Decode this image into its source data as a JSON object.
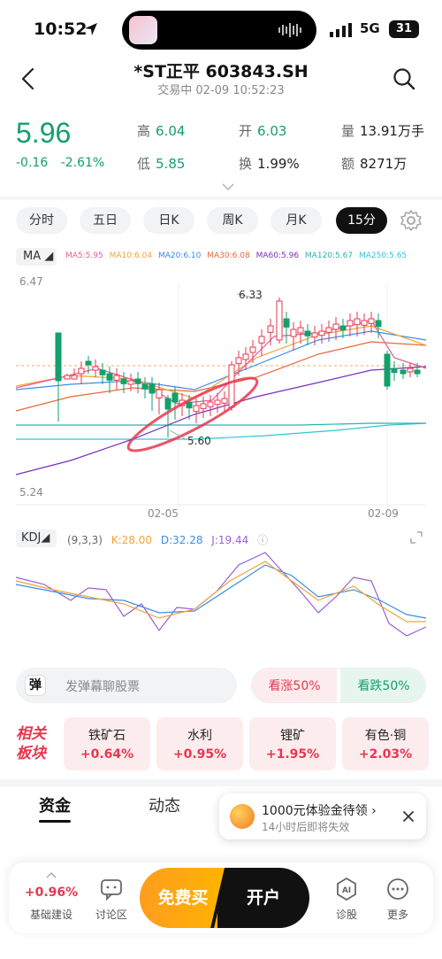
{
  "status_bar": {
    "time": "10:52",
    "network": "5G",
    "battery": "31"
  },
  "header": {
    "title": "*ST正平 603843.SH",
    "subtitle": "交易中 02-09 10:52:23"
  },
  "quote": {
    "price": "5.96",
    "change": "-0.16",
    "change_pct": "-2.61%",
    "high_label": "高",
    "high": "6.04",
    "low_label": "低",
    "low": "5.85",
    "open_label": "开",
    "open": "6.03",
    "turnover_label": "换",
    "turnover": "1.99%",
    "volume_label": "量",
    "volume": "13.91万手",
    "amount_label": "额",
    "amount": "8271万"
  },
  "period_tabs": [
    "分时",
    "五日",
    "日K",
    "周K",
    "月K",
    "15分"
  ],
  "active_tab": "15分",
  "ma": {
    "selector": "MA",
    "items": [
      {
        "label": "MA5:5.95",
        "color": "#e85a9a"
      },
      {
        "label": "MA10:6.04",
        "color": "#f2a33a"
      },
      {
        "label": "MA20:6.10",
        "color": "#3a8ee6"
      },
      {
        "label": "MA30:6.08",
        "color": "#e8673a"
      },
      {
        "label": "MA60:5.96",
        "color": "#7b2fbf"
      },
      {
        "label": "MA120:5.67",
        "color": "#2bb3a6"
      },
      {
        "label": "MA250:5.65",
        "color": "#33c3d6"
      }
    ]
  },
  "chart_labels": {
    "y_top": "6.47",
    "y_bottom": "5.24",
    "high_mark": "6.33",
    "low_mark": "5.60",
    "x_left": "02-05",
    "x_right": "02-09"
  },
  "chart_data": {
    "type": "candlestick",
    "ylim": [
      5.24,
      6.47
    ],
    "x_ticks": [
      "02-05",
      "02-09"
    ],
    "annotations": [
      {
        "label": "6.33",
        "kind": "high"
      },
      {
        "label": "5.60",
        "kind": "low"
      }
    ]
  },
  "kdj": {
    "selector": "KDJ",
    "params": "(9,3,3)",
    "k": "K:28.00",
    "d": "D:32.28",
    "j": "J:19.44",
    "colors": {
      "k": "#f2a33a",
      "d": "#3a8ee6",
      "j": "#9b5fd6"
    }
  },
  "danmu": {
    "icon": "弹",
    "placeholder": "发弹幕聊股票"
  },
  "vote": {
    "up": "看涨50%",
    "down": "看跌50%"
  },
  "sectors": {
    "title_line1": "相关",
    "title_line2": "板块",
    "items": [
      {
        "name": "铁矿石",
        "change": "+0.64%"
      },
      {
        "name": "水利",
        "change": "+0.95%"
      },
      {
        "name": "锂矿",
        "change": "+1.95%"
      },
      {
        "name": "有色·铜",
        "change": "+2.03%"
      }
    ]
  },
  "bottom_tabs": [
    "资金",
    "动态"
  ],
  "promo": {
    "title": "1000元体验金待领 ›",
    "subtitle": "14小时后即将失效"
  },
  "bottom_bar": {
    "index_change": "+0.96%",
    "index_label": "基础建设",
    "discuss": "讨论区",
    "buy": "免费买",
    "open_account": "开户",
    "diagnose": "诊股",
    "more": "更多"
  }
}
